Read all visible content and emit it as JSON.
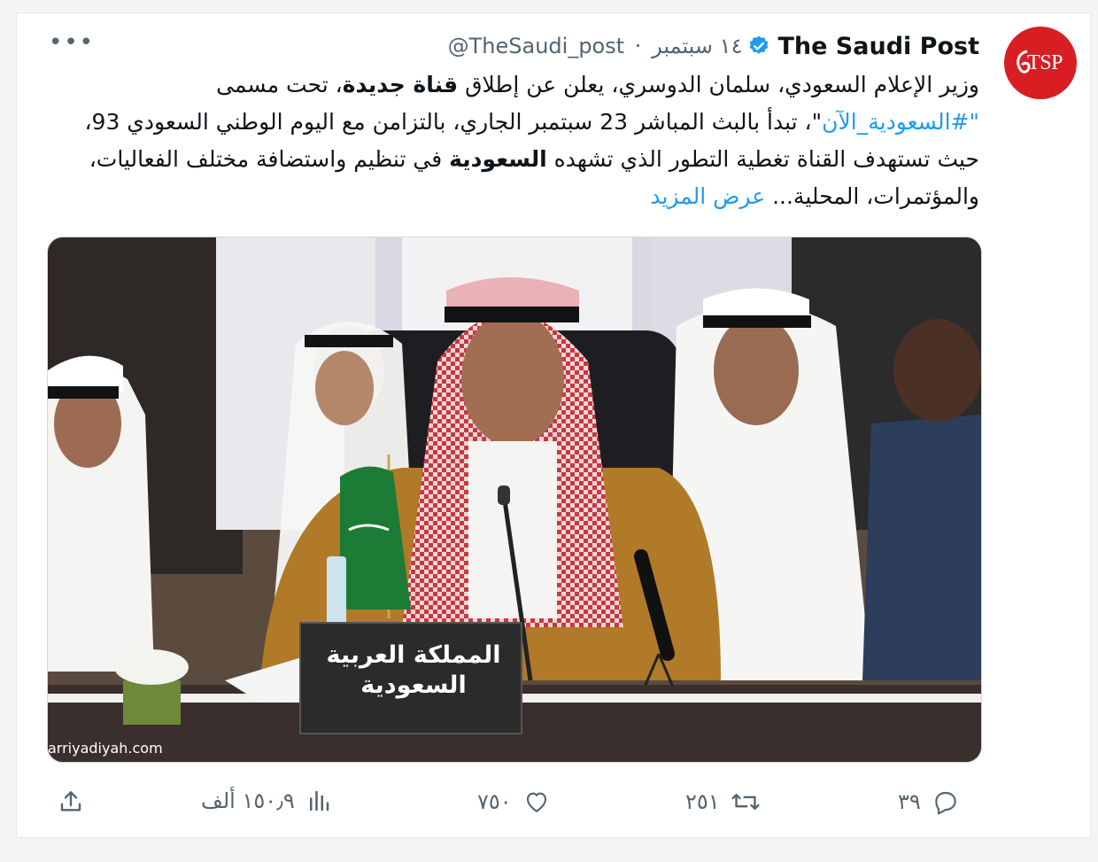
{
  "tweet": {
    "display_name": "The Saudi Post",
    "handle": "@TheSaudi_post",
    "separator": "·",
    "date": "١٤ سبتمبر",
    "avatar_text": "TSP",
    "more_label": "•••",
    "text": {
      "p1": "وزير الإعلام السعودي، سلمان الدوسري، يعلن عن إطلاق ",
      "p2_bold": "قناة جديدة",
      "p3": "، تحت مسمى ",
      "hashtag": "\"#السعودية_الآن",
      "p4": "\"، تبدأ بالبث المباشر 23 سبتمبر الجاري، بالتزامن مع اليوم الوطني السعودي 93، حيث تستهدف القناة تغطية التطور الذي تشهده ",
      "p5_bold": "السعودية",
      "p6": " في تنظيم واستضافة مختلف الفعاليات، والمؤتمرات، المحلية... ",
      "show_more": "عرض المزيد"
    },
    "media": {
      "watermark": "arriyadiyah.com",
      "nameplate_line1": "المملكة العربية",
      "nameplate_line2": "السعودية"
    },
    "actions": {
      "replies": "٣٩",
      "retweets": "٢٥١",
      "likes": "٧٥٠",
      "views": "١٥٠٫٩ ألف"
    }
  },
  "colors": {
    "accent": "#1d9bf0",
    "text": "#0f1419",
    "muted": "#536471",
    "avatar": "#d81e23"
  }
}
